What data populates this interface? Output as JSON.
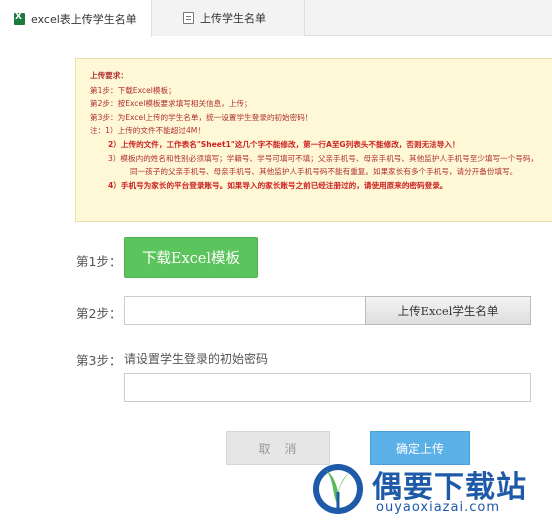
{
  "tabs": [
    {
      "label": "excel表上传学生名单",
      "icon": "excel-icon",
      "active": true
    },
    {
      "label": "上传学生名单",
      "icon": "list-icon",
      "active": false
    }
  ],
  "notice": {
    "title": "上传要求：",
    "lines": [
      "第1步：下载Excel模板；",
      "第2步：按Excel模板要求填写相关信息，上传；",
      "第3步：为Excel上传的学生名单，统一设置学生登录的初始密码！",
      "注：1）上传的文件不能超过4M！"
    ],
    "sub_lines": [
      "2）上传的文件，工作表名\"Sheet1\"这几个字不能修改，第一行A至G列表头不能修改，否则无法导入！",
      "3）模板内的姓名和性别必须填写；学籍号、学号可填可不填；父亲手机号、母亲手机号、其他监护人手机号至少填写一个号码，",
      "同一孩子的父亲手机号、母亲手机号、其他监护人手机号码不能有重复。如果家长有多个手机号，请分开备份填写。",
      "4）手机号为家长的平台登录账号。如果导入的家长账号之前已经注册过的，请使用原来的密码登录。"
    ]
  },
  "step1": {
    "label": "第1步：",
    "button": "下载Excel模板"
  },
  "step2": {
    "label": "第2步：",
    "file_value": "",
    "button": "上传Excel学生名单"
  },
  "step3": {
    "label": "第3步：",
    "text": "请设置学生登录的初始密码",
    "value": ""
  },
  "actions": {
    "cancel": "取　消",
    "confirm": "确定上传"
  },
  "watermark": {
    "title": "偶要下载站",
    "domain": "ouyaoxiazai.com"
  },
  "colors": {
    "accent_green": "#5cc45c",
    "accent_blue": "#5bb0e8",
    "notice_bg": "#fff8d6",
    "notice_text": "#b03030",
    "watermark": "#1e5aa8"
  }
}
